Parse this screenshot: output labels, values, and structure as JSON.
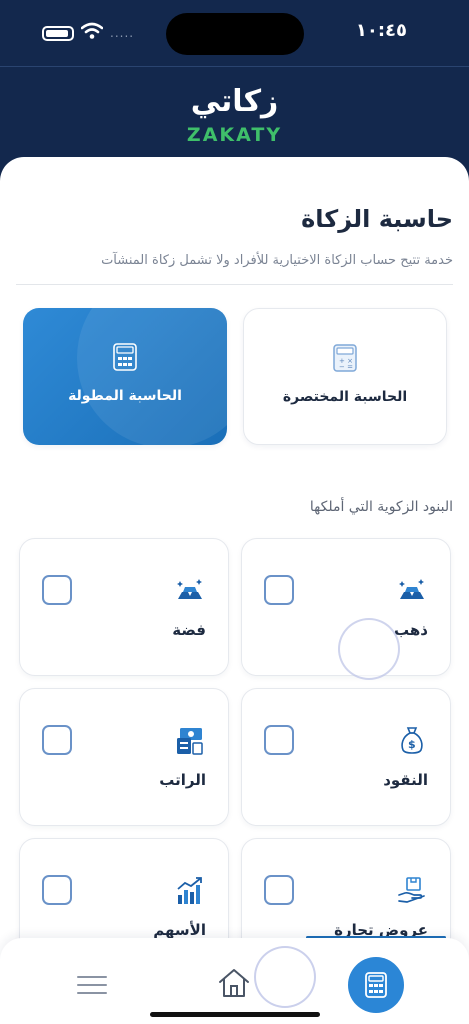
{
  "status_bar": {
    "time": "١٠:٤٥",
    "signal": "....."
  },
  "brand": {
    "name_ar": "زكاتي",
    "name_en": "ZAKATY",
    "accent": "#3fbf6a",
    "header_bg": "#13284d"
  },
  "page": {
    "title": "حاسبة الزكاة",
    "subtitle": "خدمة تتيح حساب الزكاة الاختيارية للأفراد ولا تشمل زكاة المنشآت"
  },
  "calculators": {
    "short": {
      "label": "الحاسبة المختصرة",
      "icon": "calculator-icon"
    },
    "long": {
      "label": "الحاسبة المطولة",
      "icon": "calculator-icon",
      "accent": "#2b86d6"
    }
  },
  "section": {
    "title": "البنود الزكوية التي أملكها"
  },
  "items": [
    {
      "label": "ذهب",
      "icon": "gold-bars-icon",
      "checked": false
    },
    {
      "label": "فضة",
      "icon": "silver-bars-icon",
      "checked": false
    },
    {
      "label": "النقود",
      "icon": "money-bag-icon",
      "checked": false
    },
    {
      "label": "الراتب",
      "icon": "salary-icon",
      "checked": false
    },
    {
      "label": "عروض تجارة",
      "icon": "trade-goods-icon",
      "checked": false
    },
    {
      "label": "الأسهم",
      "icon": "stocks-chart-icon",
      "checked": false
    }
  ],
  "bottom_nav": {
    "items": [
      {
        "icon": "menu-icon"
      },
      {
        "icon": "home-icon"
      },
      {
        "icon": "calculator-icon",
        "active": true
      }
    ]
  }
}
